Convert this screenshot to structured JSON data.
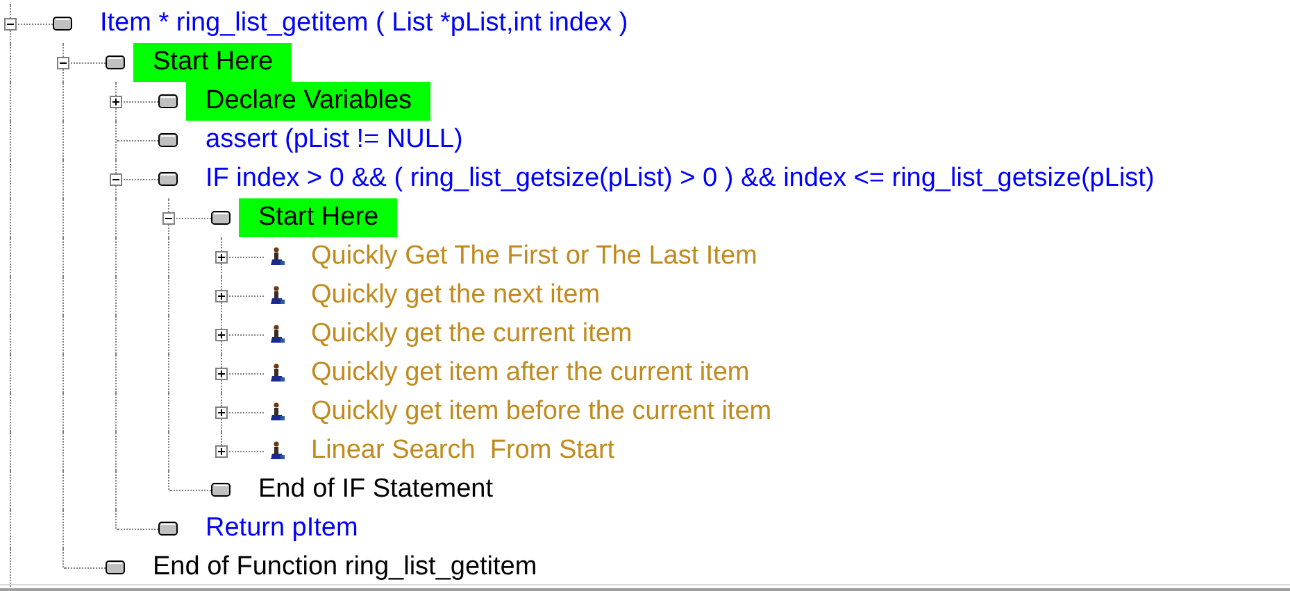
{
  "tree": [
    {
      "label": "Item * ring_list_getitem ( List *pList,int index )",
      "kind": "block",
      "color": "#0000ff",
      "highlighted": false,
      "expanded": true,
      "children": [
        {
          "label": "Start Here",
          "kind": "block",
          "color": "#000000",
          "highlighted": true,
          "expanded": true,
          "children": [
            {
              "label": "Declare Variables",
              "kind": "block",
              "color": "#000000",
              "highlighted": true,
              "expanded": false
            },
            {
              "label": "assert (pList != NULL)",
              "kind": "block",
              "color": "#0000ff",
              "highlighted": false
            },
            {
              "label": "IF index > 0 && ( ring_list_getsize(pList) > 0 ) && index <= ring_list_getsize(pList)",
              "kind": "block",
              "color": "#0000ff",
              "highlighted": false,
              "expanded": true,
              "children": [
                {
                  "label": "Start Here",
                  "kind": "block",
                  "color": "#000000",
                  "highlighted": true,
                  "expanded": true,
                  "children": [
                    {
                      "label": "Quickly Get The First or The Last Item",
                      "kind": "step",
                      "color": "#c08a1c",
                      "highlighted": false,
                      "expanded": false
                    },
                    {
                      "label": "Quickly get the next item",
                      "kind": "step",
                      "color": "#c08a1c",
                      "highlighted": false,
                      "expanded": false
                    },
                    {
                      "label": "Quickly get the current item",
                      "kind": "step",
                      "color": "#c08a1c",
                      "highlighted": false,
                      "expanded": false
                    },
                    {
                      "label": "Quickly get item after the current item",
                      "kind": "step",
                      "color": "#c08a1c",
                      "highlighted": false,
                      "expanded": false
                    },
                    {
                      "label": "Quickly get item before the current item",
                      "kind": "step",
                      "color": "#c08a1c",
                      "highlighted": false,
                      "expanded": false
                    },
                    {
                      "label": "Linear Search  From Start",
                      "kind": "step",
                      "color": "#c08a1c",
                      "highlighted": false,
                      "expanded": false
                    }
                  ]
                },
                {
                  "label": "End of IF Statement",
                  "kind": "block",
                  "color": "#000000",
                  "highlighted": false
                }
              ]
            },
            {
              "label": "Return pItem",
              "kind": "block",
              "color": "#0000ff",
              "highlighted": false
            }
          ]
        },
        {
          "label": "End of Function ring_list_getitem",
          "kind": "block",
          "color": "#000000",
          "highlighted": false
        }
      ]
    }
  ]
}
